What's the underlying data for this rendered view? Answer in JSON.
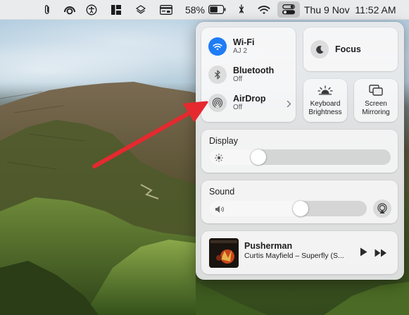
{
  "menubar": {
    "battery_percent": "58%",
    "datetime": "Thu 9 Nov  11:52 AM",
    "icons": [
      "paperclip-icon",
      "headphones-icon",
      "accessibility-icon",
      "layout-icon",
      "layers-icon",
      "card-icon",
      "battery-icon",
      "mute-icon",
      "wifi-icon",
      "control-center-icon"
    ]
  },
  "control_center": {
    "wifi": {
      "label": "Wi-Fi",
      "status": "AJ 2",
      "enabled": true
    },
    "bluetooth": {
      "label": "Bluetooth",
      "status": "Off",
      "enabled": false
    },
    "airdrop": {
      "label": "AirDrop",
      "status": "Off",
      "enabled": false
    },
    "focus": {
      "label": "Focus"
    },
    "keyboard_brightness": {
      "label_line1": "Keyboard",
      "label_line2": "Brightness"
    },
    "screen_mirroring": {
      "label_line1": "Screen",
      "label_line2": "Mirroring"
    },
    "display": {
      "title": "Display",
      "level": 0.25
    },
    "sound": {
      "title": "Sound",
      "level": 0.59
    },
    "now_playing": {
      "title": "Pusherman",
      "subtitle": "Curtis Mayfield – Superfly (S..."
    }
  },
  "colors": {
    "accent_blue": "#1f7cf5",
    "annotation_arrow": "#e5292f"
  }
}
